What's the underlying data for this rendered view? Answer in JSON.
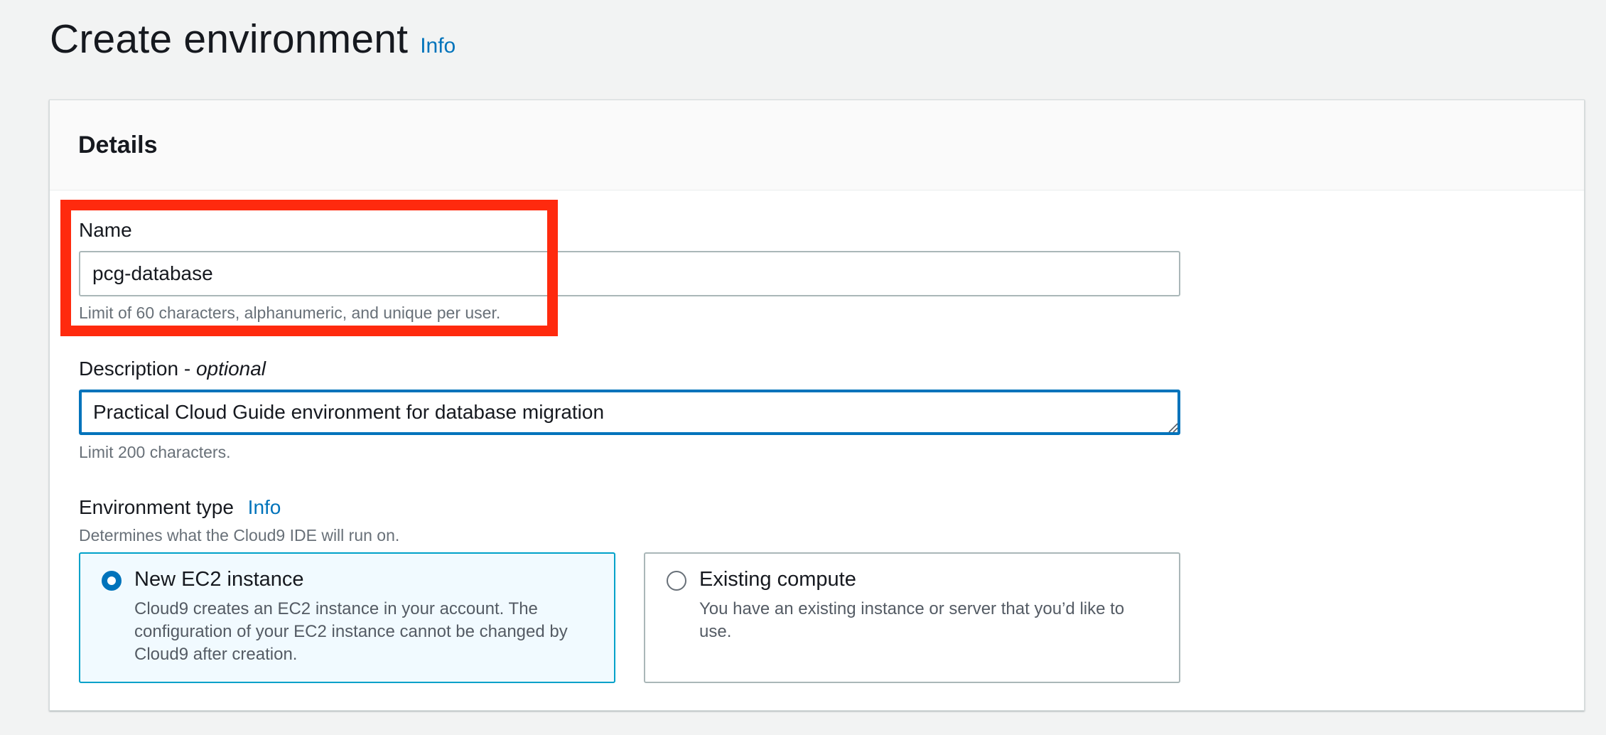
{
  "page": {
    "title": "Create environment",
    "info_label": "Info"
  },
  "details": {
    "heading": "Details",
    "name": {
      "label": "Name",
      "value": "pcg-database",
      "hint": "Limit of 60 characters, alphanumeric, and unique per user."
    },
    "description": {
      "label": "Description - ",
      "label_optional": "optional",
      "value": "Practical Cloud Guide environment for database migration",
      "hint": "Limit 200 characters."
    },
    "environment_type": {
      "label": "Environment type",
      "info_label": "Info",
      "hint": "Determines what the Cloud9 IDE will run on.",
      "options": [
        {
          "title": "New EC2 instance",
          "description": "Cloud9 creates an EC2 instance in your account. The configuration of your EC2 instance cannot be changed by Cloud9 after creation.",
          "selected": true
        },
        {
          "title": "Existing compute",
          "description": "You have an existing instance or server that you’d like to use.",
          "selected": false
        }
      ]
    }
  },
  "colors": {
    "link": "#0073bb",
    "focus_border": "#0073bb",
    "selected_tile_bg": "#f1faff",
    "selected_tile_border": "#00a1c9",
    "annotation": "#ff2a0e"
  }
}
